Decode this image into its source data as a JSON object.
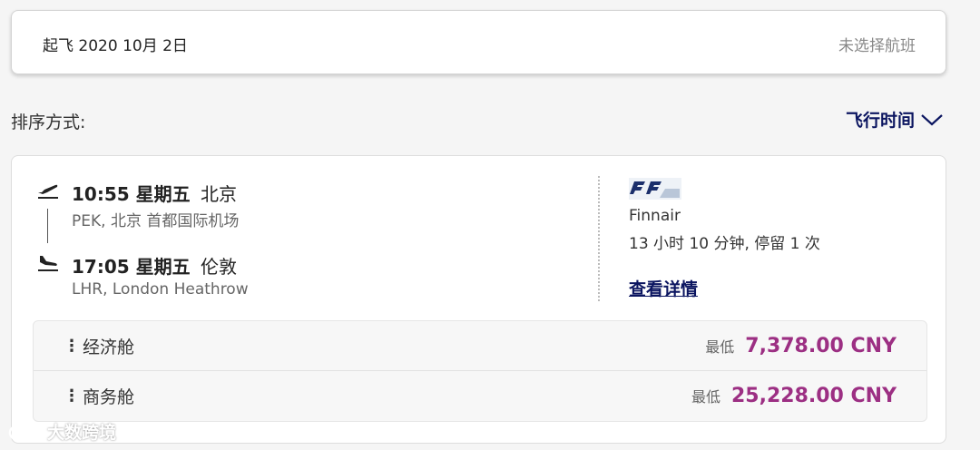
{
  "date_card": {
    "departure": "起飞 2020 10月 2日",
    "status": "未选择航班"
  },
  "sort": {
    "label": "排序方式:",
    "value": "飞行时间",
    "icon": "chevron-down-icon"
  },
  "flight": {
    "departure": {
      "time": "10:55 星期五",
      "city": "北京",
      "airport": "PEK, 北京 首都国际机场",
      "icon": "takeoff-icon"
    },
    "arrival": {
      "time": "17:05 星期五",
      "city": "伦敦",
      "airport": "LHR, London Heathrow",
      "icon": "landing-icon"
    },
    "airline": "Finnair",
    "duration": "13 小时 10 分钟, 停留 1 次",
    "details_link": "查看详情"
  },
  "fares": [
    {
      "cabin": "经济舱",
      "from_label": "最低",
      "price": "7,378.00 CNY"
    },
    {
      "cabin": "商务舱",
      "from_label": "最低",
      "price": "25,228.00 CNY"
    }
  ],
  "colors": {
    "brand_navy": "#0b1560",
    "price_purple": "#9c2f83"
  },
  "watermark": "大数跨境"
}
